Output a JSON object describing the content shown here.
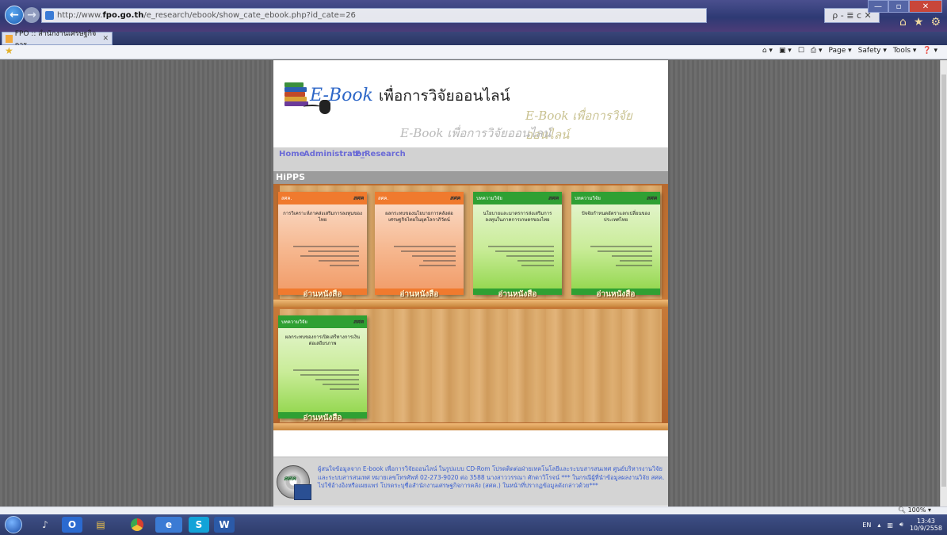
{
  "browser": {
    "url_prefix": "http://www.",
    "url_host": "fpo.go.th",
    "url_path": "/e_research/ebook/show_cate_ebook.php?id_cate=26",
    "address_tools": "ρ - ≣ c ✕",
    "tab_title": "FPO :: สำนักงานเศรษฐกิจการ...",
    "tab_close": "✕",
    "win_minimize": "—",
    "win_maximize": "▫",
    "win_close": "✕",
    "right_icons": [
      "⌂",
      "★",
      "⚙"
    ],
    "command_bar": [
      "⌂ ▾",
      "▣ ▾",
      "☐",
      "⎙ ▾",
      "Page ▾",
      "Safety ▾",
      "Tools ▾",
      "❓ ▾"
    ],
    "zoom": "100%"
  },
  "banner": {
    "logo_latin": "E-Book",
    "logo_thai": "เพื่อการวิจัยออนไลน์",
    "echo1": "E-Book เพื่อการวิจัยออนไลน์",
    "echo2": "E-Book เพื่อการวิจัยออนไลน์"
  },
  "menu": {
    "home": "Home",
    "administrator": "Administrator",
    "e_research": "E_Research"
  },
  "section": {
    "title": "HiPPS"
  },
  "books": [
    {
      "theme": "orange",
      "tag": "สศค.",
      "brand": "สศค",
      "title": "การวิเคราะห์ภาคส่งเสริมการลงทุนของไทย",
      "read": "อ่านหนังสือ"
    },
    {
      "theme": "orange",
      "tag": "สศค.",
      "brand": "สศค",
      "title": "ผลกระทบของนโยบายการคลังต่อเศรษฐกิจไทยในยุคโลกาภิวัตน์",
      "read": "อ่านหนังสือ"
    },
    {
      "theme": "green",
      "tag": "บทความวิจัย",
      "brand": "สศค",
      "title": "นโยบายและมาตรการส่งเสริมการลงทุนในภาคการเกษตรของไทย",
      "read": "อ่านหนังสือ"
    },
    {
      "theme": "green",
      "tag": "บทความวิจัย",
      "brand": "สศค",
      "title": "ปัจจัยกำหนดอัตราแลกเปลี่ยนของประเทศไทย",
      "read": "อ่านหนังสือ"
    },
    {
      "theme": "green",
      "tag": "บทความวิจัย",
      "brand": "สศค",
      "title": "ผลกระทบของการเปิดเสรีทางการเงินต่อเสถียรภาพ",
      "read": "อ่านหนังสือ"
    }
  ],
  "footer": {
    "cd_label": "สศค",
    "text": "ผู้สนใจข้อมูลจาก E-book เพื่อการวิจัยออนไลน์ ในรูปแบบ CD-Rom โปรดติดต่อฝ่ายเทคโนโลยีและระบบสารสนเทศ ศูนย์บริหารงานวิจัยและระบบสารสนเทศ หมายเลขโทรศัพท์ 02-273-9020 ต่อ 3588 นางสาววรรณา ศักดาวิโรจน์ *** ในกรณีผู้ที่นำข้อมูลผลงานวิจัย สศค. ไปใช้อ้างอิงหรือเผยแพร่ โปรดระบุชื่อสำนักงานเศรษฐกิจการคลัง (สศค.) ในหน้าที่ปรากฏข้อมูลดังกล่าวด้วย***"
  },
  "taskbar": {
    "items": [
      "S",
      "W"
    ],
    "lang": "EN",
    "time": "13:43",
    "date": "10/9/2558"
  }
}
